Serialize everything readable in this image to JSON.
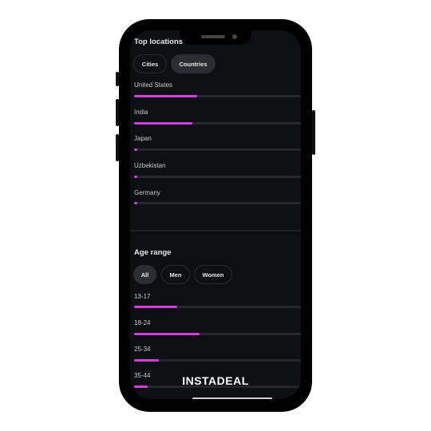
{
  "top_locations": {
    "title": "Top locations",
    "tabs": [
      {
        "label": "Cities",
        "active": false
      },
      {
        "label": "Countries",
        "active": true
      }
    ],
    "rows": [
      {
        "label": "United States",
        "value_fraction": 0.38
      },
      {
        "label": "India",
        "value_fraction": 0.35
      },
      {
        "label": "Japan",
        "value_fraction": 0.02
      },
      {
        "label": "Uzbekistan",
        "value_fraction": 0.02
      },
      {
        "label": "Germany",
        "value_fraction": 0.02
      }
    ]
  },
  "age_range": {
    "title": "Age range",
    "tabs": [
      {
        "label": "All",
        "active": true
      },
      {
        "label": "Men",
        "active": false
      },
      {
        "label": "Women",
        "active": false
      }
    ],
    "rows": [
      {
        "label": "13-17",
        "value_fraction": 0.26
      },
      {
        "label": "18-24",
        "value_fraction": 0.39
      },
      {
        "label": "25-34",
        "value_fraction": 0.15
      },
      {
        "label": "35-44",
        "value_fraction": 0.08
      }
    ]
  },
  "watermark": "INSTADEAL",
  "colors": {
    "accent": "#d43ee0",
    "background": "#0d0f12",
    "track": "#23262b"
  }
}
